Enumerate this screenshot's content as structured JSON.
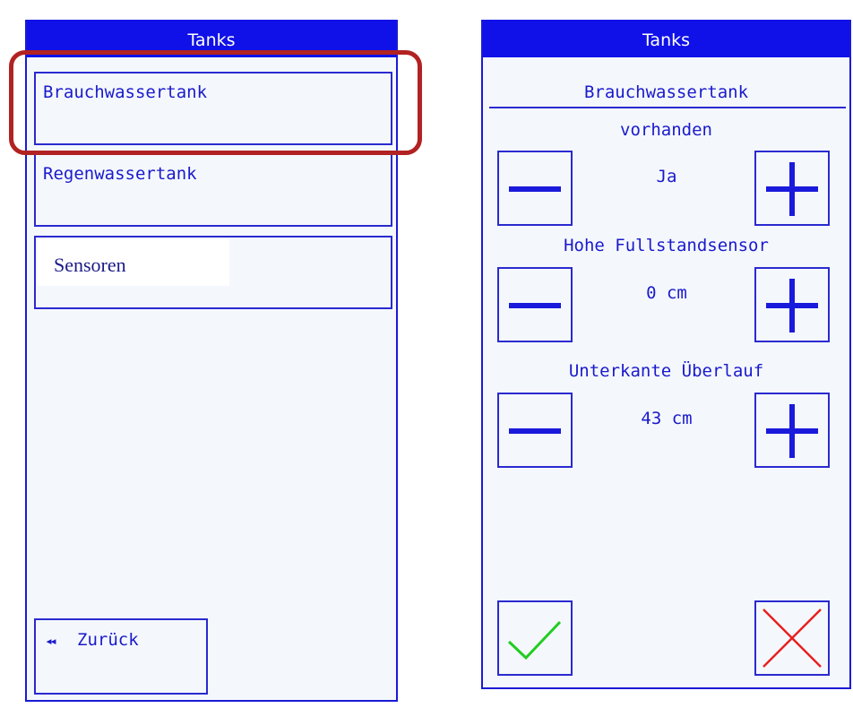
{
  "left_panel": {
    "title": "Tanks",
    "items": [
      {
        "label": "Brauchwassertank"
      },
      {
        "label": "Regenwassertank"
      },
      {
        "label": "Sensoren"
      }
    ],
    "back_arrow": "◂◂",
    "back_label": "Zurück",
    "highlight_color": "#b22222"
  },
  "right_panel": {
    "title": "Tanks",
    "subtitle": "Brauchwassertank",
    "params": [
      {
        "label": "vorhanden",
        "value": "Ja"
      },
      {
        "label": "Hohe Fullstandsensor",
        "value": "0 cm"
      },
      {
        "label": "Unterkante Überlauf",
        "value": "43 cm"
      }
    ],
    "buttons": {
      "minus_icon": "minus-icon",
      "plus_icon": "plus-icon",
      "confirm_icon": "checkmark-icon",
      "cancel_icon": "cross-icon"
    }
  },
  "colors": {
    "header": "#1010e8",
    "text": "#1a1acc",
    "confirm": "#22cc22",
    "cancel": "#e82020"
  }
}
